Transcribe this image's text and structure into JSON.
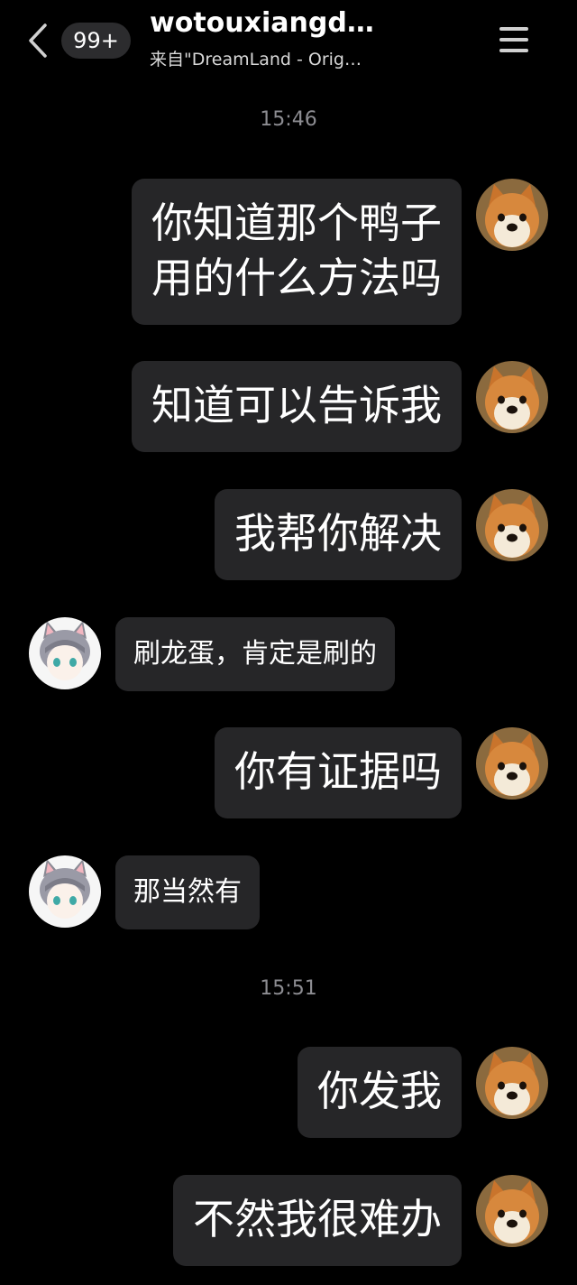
{
  "header": {
    "back_icon": "chevron-left-icon",
    "unread_badge": "99+",
    "title": "wotouxiangd…",
    "subtitle": "来自\"DreamLand - Orig…",
    "menu_icon": "hamburger-menu-icon"
  },
  "timestamps": [
    "15:46",
    "15:51"
  ],
  "messages": [
    {
      "sender": "me",
      "text": "你知道那个鸭子\n用的什么方法吗"
    },
    {
      "sender": "me",
      "text": "知道可以告诉我"
    },
    {
      "sender": "me",
      "text": "我帮你解决"
    },
    {
      "sender": "other",
      "text": "刷龙蛋，肯定是刷的"
    },
    {
      "sender": "me",
      "text": "你有证据吗"
    },
    {
      "sender": "other",
      "text": "那当然有"
    },
    {
      "sender": "me",
      "text": "你发我"
    },
    {
      "sender": "me",
      "text": "不然我很难办"
    }
  ],
  "colors": {
    "background": "#000000",
    "bubble": "#262628",
    "timestamp": "#8d8d92",
    "badge": "#2c2c2e"
  }
}
